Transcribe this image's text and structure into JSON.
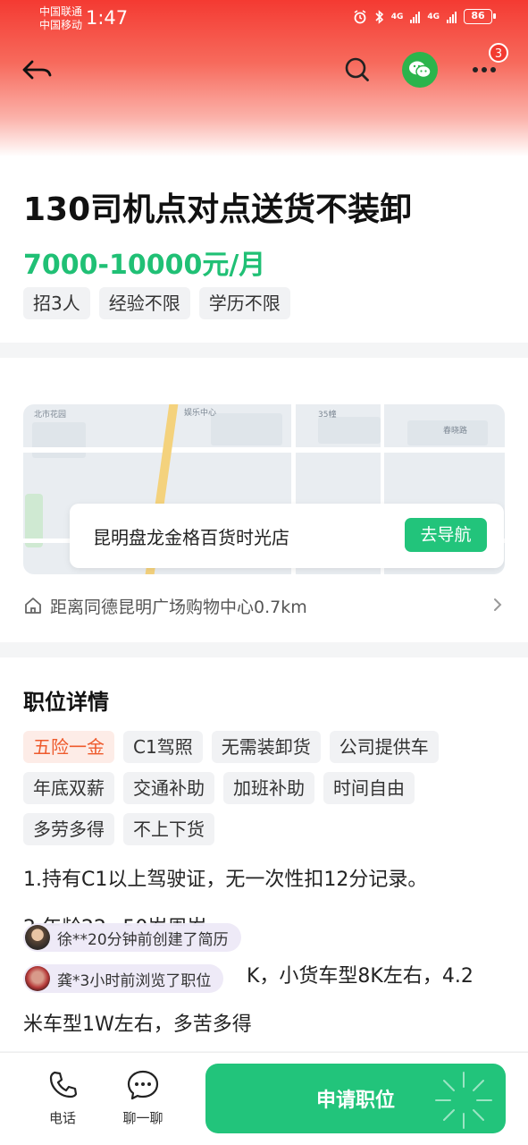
{
  "status": {
    "carrier1": "中国联通",
    "carrier2": "中国移动",
    "time": "1:47",
    "battery": "86",
    "net1": "4G",
    "net2": "4G"
  },
  "header": {
    "notification_count": "3"
  },
  "job": {
    "title": "130司机点对点送货不装卸",
    "salary": "7000-10000元/月",
    "requirements": [
      "招3人",
      "经验不限",
      "学历不限"
    ]
  },
  "location": {
    "store": "昆明盘龙金格百货时光店",
    "nav_label": "去导航",
    "distance": "距离同德昆明广场购物中心0.7km"
  },
  "details": {
    "heading": "职位详情",
    "tags": [
      [
        "五险一金",
        "C1驾照",
        "无需装卸货",
        "公司提供车"
      ],
      [
        "年底双薪",
        "交通补助",
        "加班补助",
        "时间自由"
      ],
      [
        "多劳多得",
        "不上下货"
      ]
    ],
    "lines": [
      "1.持有C1以上驾驶证，无一次性扣12分记录。",
      "2.年龄22~50岁周岁",
      "K，小货车型8K左右，4.2",
      "米车型1W左右，多苦多得"
    ]
  },
  "toasts": [
    {
      "text": "徐**20分钟前创建了简历"
    },
    {
      "text": "龚*3小时前浏览了职位"
    }
  ],
  "bottom": {
    "phone_label": "电话",
    "chat_label": "聊一聊",
    "apply_label": "申请职位"
  },
  "colors": {
    "header_red": "#f43a32",
    "accent_green": "#20c075",
    "button_green": "#22c47b",
    "hot_tag": "#ee5a2c"
  }
}
